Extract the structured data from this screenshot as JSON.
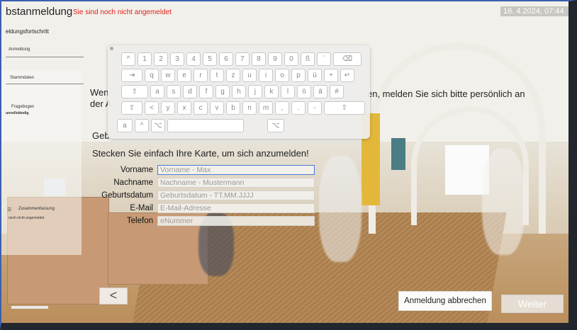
{
  "header": {
    "title": "bstanmeldung",
    "login_status": "Sie sind noch nicht angemeldet",
    "datetime": "16. 4.2024, 07:44"
  },
  "sidebar": {
    "title": "eldungsfortschritt",
    "steps": [
      {
        "label": "Anmeldung"
      },
      {
        "label": "Stammdaten"
      },
      {
        "label": "Fragebogen",
        "status": "unvollständig"
      },
      {
        "label": "Zusammenfassung",
        "status": "noch nicht angemeldet"
      }
    ]
  },
  "form": {
    "intro_line1_left": "Wen",
    "intro_line1_right": "en, melden Sie sich bitte persönlich an",
    "intro_line2": "der A",
    "intro_line3": "Geb",
    "card_hint": "Stecken Sie einfach Ihre Karte, um sich anzumelden!",
    "fields": [
      {
        "label": "Vorname",
        "placeholder": "Vorname - Max"
      },
      {
        "label": "Nachname",
        "placeholder": "Nachname - Mustermann"
      },
      {
        "label": "Geburtsdatum",
        "placeholder": "Geburtsdatum - TT.MM.JJJJ"
      },
      {
        "label": "E-Mail",
        "placeholder": "E-Mail-Adresse"
      },
      {
        "label": "Telefon",
        "placeholder": "eNummer"
      }
    ]
  },
  "buttons": {
    "back": "<",
    "cancel": "Anmeldung abbrechen",
    "next": "Weiter"
  },
  "keyboard": {
    "row1": [
      "^",
      "1",
      "2",
      "3",
      "4",
      "5",
      "6",
      "7",
      "8",
      "9",
      "0",
      "ß",
      "´",
      "⌫"
    ],
    "row2": [
      "⇥",
      "q",
      "w",
      "e",
      "r",
      "t",
      "z",
      "u",
      "i",
      "o",
      "p",
      "ü",
      "+",
      "↵"
    ],
    "row3": [
      "⇧",
      "a",
      "s",
      "d",
      "f",
      "g",
      "h",
      "j",
      "k",
      "l",
      "ö",
      "ä",
      "#"
    ],
    "row4": [
      "⇧",
      "<",
      "y",
      "x",
      "c",
      "v",
      "b",
      "n",
      "m",
      ",",
      ".",
      "-",
      "⇧"
    ],
    "row5": [
      "a",
      "^",
      "⌥",
      " ",
      "⌥"
    ]
  }
}
